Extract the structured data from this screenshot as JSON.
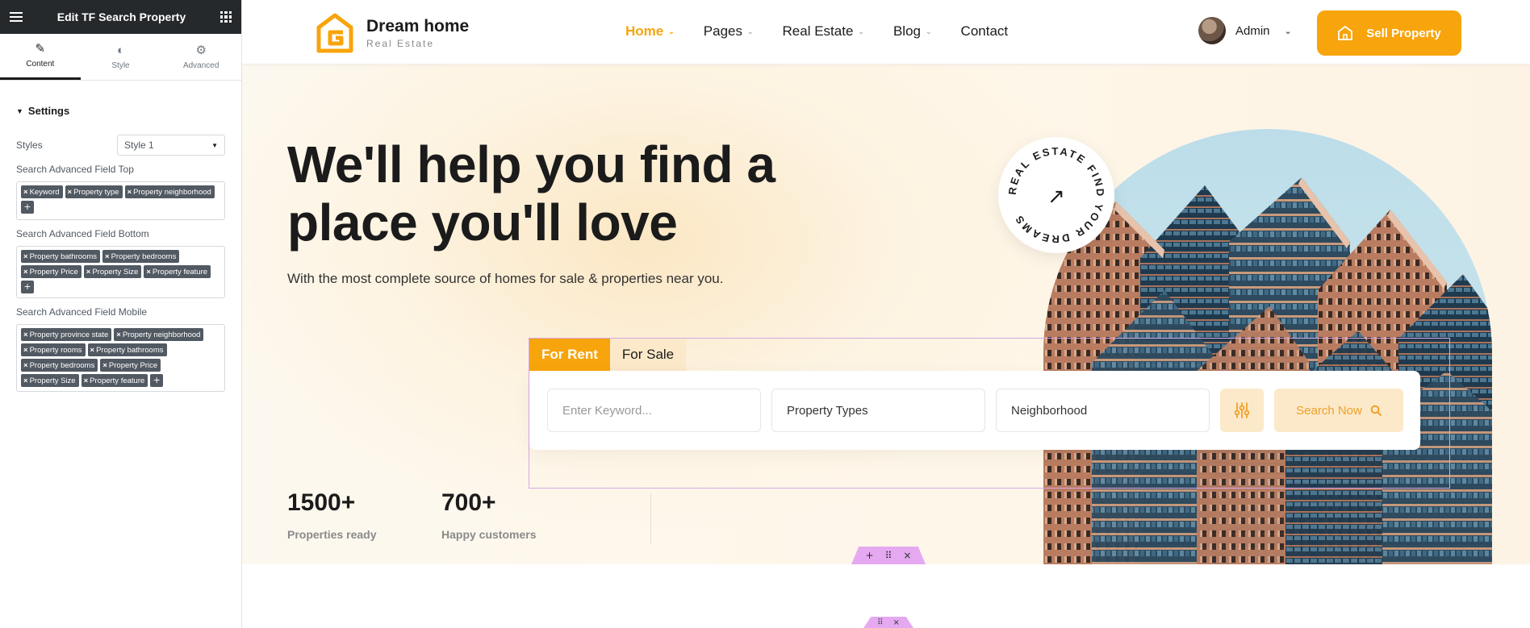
{
  "editor": {
    "title": "Edit TF Search Property",
    "tabs": [
      {
        "label": "Content"
      },
      {
        "label": "Style"
      },
      {
        "label": "Advanced"
      }
    ],
    "section_title": "Settings",
    "styles_label": "Styles",
    "styles_value": "Style 1",
    "fields": [
      {
        "label": "Search Advanced Field Top",
        "tags": [
          "Keyword",
          "Property type",
          "Property neighborhood"
        ]
      },
      {
        "label": "Search Advanced Field Bottom",
        "tags": [
          "Property bathrooms",
          "Property bedrooms",
          "Property Price",
          "Property Size",
          "Property feature"
        ]
      },
      {
        "label": "Search Advanced Field Mobile",
        "tags": [
          "Property province state",
          "Property neighborhood",
          "Property rooms",
          "Property bathrooms",
          "Property bedrooms",
          "Property Price",
          "Property Size",
          "Property feature"
        ]
      }
    ],
    "tag_remove": "×",
    "tag_add": "+",
    "collapse": "‹"
  },
  "site": {
    "brand": {
      "name": "Dream home",
      "tagline": "Real Estate",
      "color": "#f8a40c"
    },
    "nav": [
      {
        "label": "Home",
        "active": true,
        "dropdown": true
      },
      {
        "label": "Pages",
        "dropdown": true
      },
      {
        "label": "Real Estate",
        "dropdown": true
      },
      {
        "label": "Blog",
        "dropdown": true
      },
      {
        "label": "Contact",
        "dropdown": false
      }
    ],
    "chevron": "⌄",
    "admin": {
      "label": "Admin",
      "dropdown": "⌄"
    },
    "sell_button": "Sell Property",
    "hero": {
      "title_line1": "We'll help you find a",
      "title_line2": "place you'll love",
      "subtitle": "With the most complete source of homes for sale & properties near you.",
      "badge_text": "REAL ESTATE FIND YOUR DREAMS",
      "badge_arrow": "↗"
    },
    "search": {
      "tabs": [
        "For Rent",
        "For Sale"
      ],
      "keyword_placeholder": "Enter Keyword...",
      "property_types": "Property Types",
      "neighborhood": "Neighborhood",
      "search_button": "Search Now"
    },
    "stats": [
      {
        "value": "1500+",
        "label": "Properties ready"
      },
      {
        "value": "700+",
        "label": "Happy customers"
      }
    ],
    "section_controls": {
      "add": "+",
      "move": "⠿",
      "close": "×"
    }
  },
  "colors": {
    "accent": "#f8a40c",
    "accent_light": "#fbe9c9",
    "editor_dark": "#26292c",
    "edit_outline": "#d6a7e4"
  }
}
